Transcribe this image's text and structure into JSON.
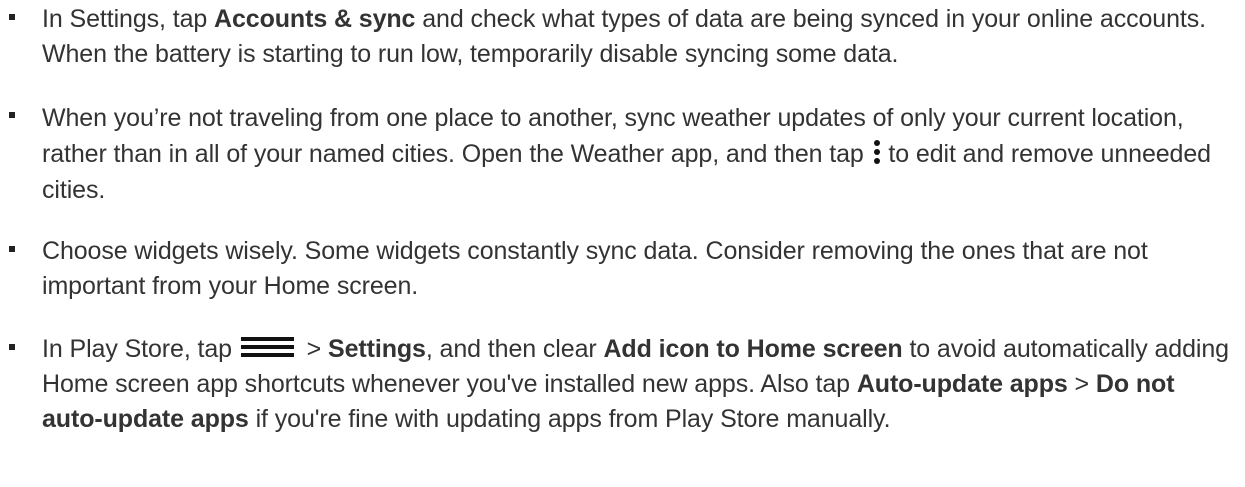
{
  "items": [
    {
      "s1": "In Settings, tap ",
      "b1": "Accounts & sync",
      "s2": " and check what types of data are being synced in your online accounts. When the battery is starting to run low, temporarily disable syncing some data."
    },
    {
      "s1": "When you’re not traveling from one place to another, sync weather updates of only your current location, rather than in all of your named cities. Open the Weather app, and then tap ",
      "s2": " to edit and remove unneeded cities."
    },
    {
      "s1": "Choose widgets wisely. Some widgets constantly sync data. Consider removing the ones that are not important from your Home screen."
    },
    {
      "s1": "In Play Store, tap ",
      "s2": " > ",
      "b1": "Settings",
      "s3": ", and then clear ",
      "b2": "Add icon to Home screen",
      "s4": " to avoid automatically adding Home screen app shortcuts whenever you've installed new apps. Also tap ",
      "b3": "Auto-update apps",
      "s5": " > ",
      "b4": "Do not auto-update apps",
      "s6": " if you're fine with updating apps from Play Store manually."
    }
  ],
  "icons": {
    "more": "more-options-icon",
    "menu": "menu-icon"
  }
}
